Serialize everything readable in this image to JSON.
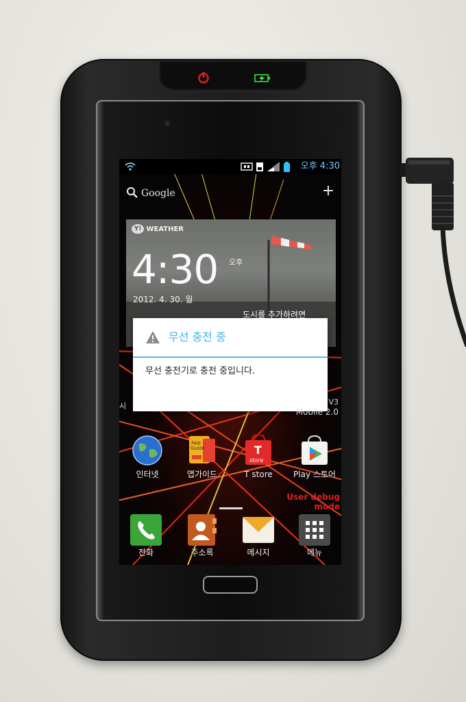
{
  "status_bar": {
    "time": "오후 4:30"
  },
  "search": {
    "label": "Google",
    "plus": "+"
  },
  "weather": {
    "brand": "WEATHER",
    "time": "4:30",
    "ampm": "오후",
    "date": "2012. 4. 30. 월",
    "location": "도시를 추가하려면"
  },
  "dialog": {
    "title": "무선 충전 중",
    "message": "무선 충전기로 충전 중입니다."
  },
  "widget_partial": {
    "left": "시",
    "right_1": "V3",
    "right_2": "Mobile 2.0"
  },
  "apps_row1": [
    {
      "label": "인터넷",
      "icon": "globe-icon"
    },
    {
      "label": "앱가이드",
      "icon": "app-guide-icon"
    },
    {
      "label": "T store",
      "icon": "t-store-icon"
    },
    {
      "label": "Play 스토어",
      "icon": "play-store-icon"
    }
  ],
  "apps_row1_icon_text": {
    "app_guide": "App Guide",
    "t_store": "store"
  },
  "debug_mode": "User debug mode",
  "dock": [
    {
      "label": "전화",
      "icon": "phone-icon"
    },
    {
      "label": "주소록",
      "icon": "contacts-icon"
    },
    {
      "label": "메시지",
      "icon": "message-icon"
    },
    {
      "label": "메뉴",
      "icon": "menu-grid-icon"
    }
  ],
  "colors": {
    "accent_blue": "#3fb4e8",
    "debug_red": "#e11d1d",
    "power_led_red": "#e0201a",
    "charge_led_green": "#33ff44"
  }
}
